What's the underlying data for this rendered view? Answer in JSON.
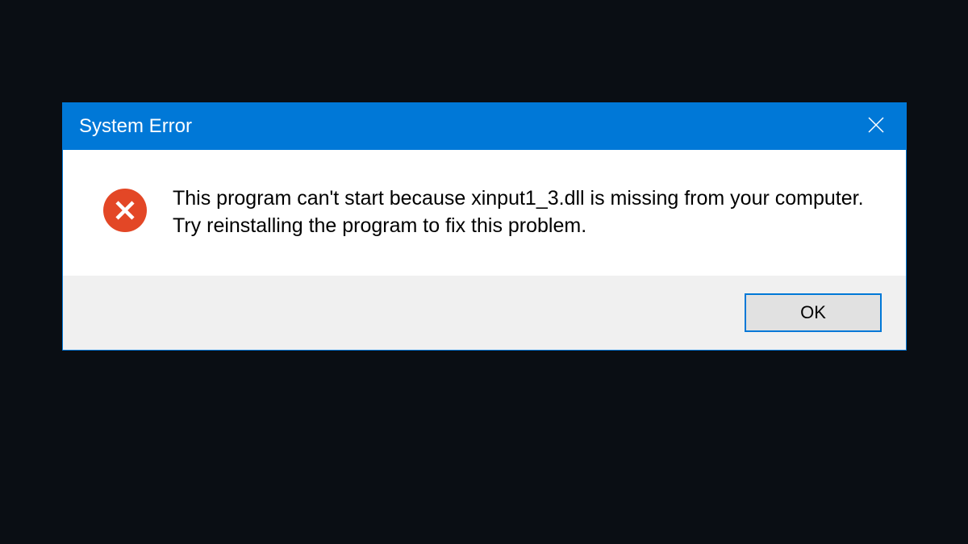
{
  "dialog": {
    "title": "System Error",
    "message": "This program can't start because xinput1_3.dll is missing from your computer. Try reinstalling the program to fix this problem.",
    "ok_label": "OK"
  },
  "colors": {
    "accent": "#0078d7",
    "error": "#e34726"
  }
}
